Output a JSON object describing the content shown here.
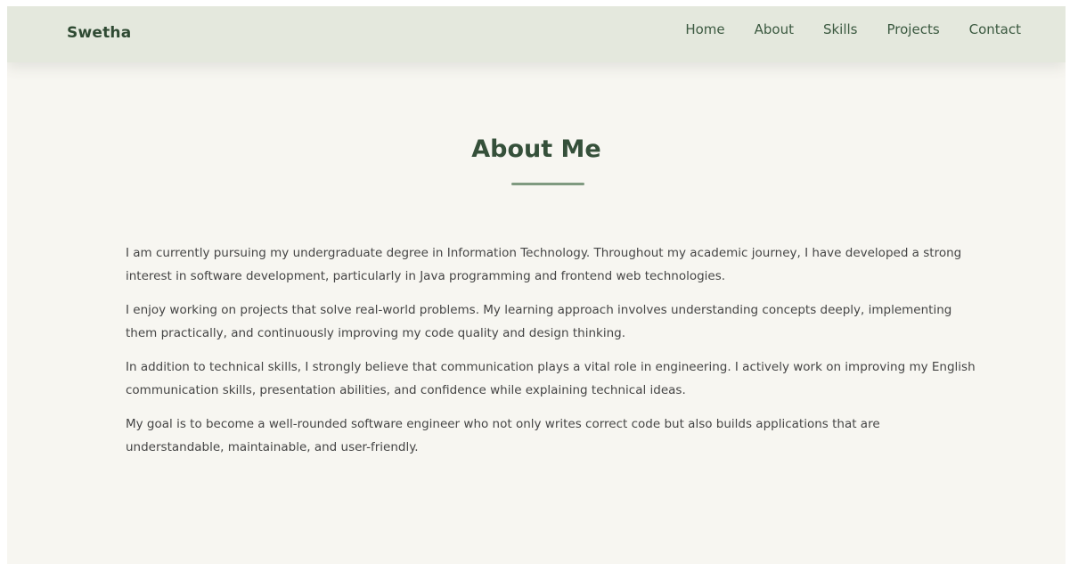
{
  "navbar": {
    "brand": "Swetha",
    "links": [
      "Home",
      "About",
      "Skills",
      "Projects",
      "Contact"
    ]
  },
  "about": {
    "title": "About Me",
    "paragraphs": [
      "I am currently pursuing my undergraduate degree in Information Technology. Throughout my academic journey, I have developed a strong interest in software development, particularly in Java programming and frontend web technologies.",
      "I enjoy working on projects that solve real-world problems. My learning approach involves understanding concepts deeply, implementing them practically, and continuously improving my code quality and design thinking.",
      "In addition to technical skills, I strongly believe that communication plays a vital role in engineering. I actively work on improving my English communication skills, presentation abilities, and confidence while explaining technical ideas.",
      "My goal is to become a well-rounded software engineer who not only writes correct code but also builds applications that are understandable, maintainable, and user-friendly."
    ]
  },
  "colors": {
    "page_bg": "#f7f6f1",
    "navbar_bg": "#e4e8dd",
    "brand": "#2f4a33",
    "accent": "#7f9a80",
    "body_text": "#454545"
  }
}
